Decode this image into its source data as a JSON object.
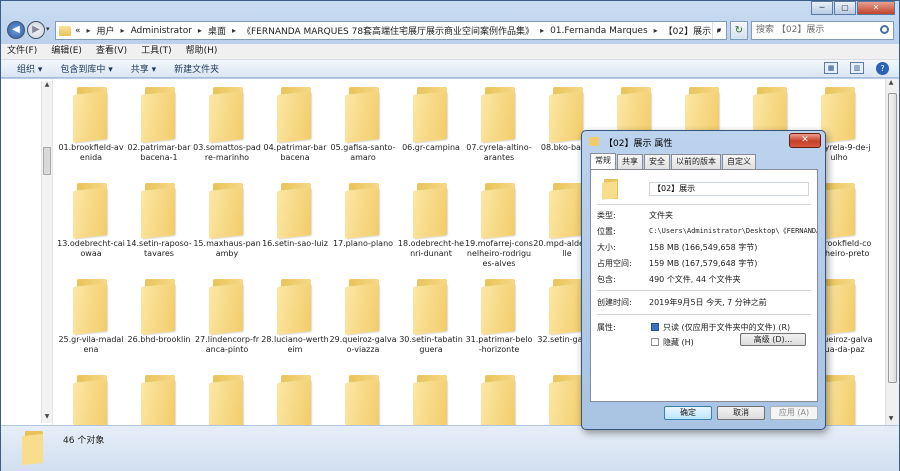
{
  "window": {
    "title": "",
    "minimize": "─",
    "maximize": "▢",
    "close": "✕"
  },
  "address": {
    "back": "◀",
    "forward": "▶",
    "crumbs": [
      "«",
      "用户",
      "Administrator",
      "桌面",
      "《FERNANDA MARQUES 78套高端住宅展厅展示商业空间案例作品集》",
      "01.Fernanda Marques",
      "【02】展示"
    ],
    "refresh": "↻",
    "search_placeholder": "搜索 【02】展示"
  },
  "menu": [
    "文件(F)",
    "编辑(E)",
    "查看(V)",
    "工具(T)",
    "帮助(H)"
  ],
  "commands": {
    "organize": "组织 ▾",
    "include": "包含到库中 ▾",
    "share": "共享 ▾",
    "new_folder": "新建文件夹",
    "view_icon": "▦",
    "pane_icon": "▥",
    "help": "?"
  },
  "files": [
    "01.brookfield-avenida",
    "02.patrimar-barbacena-1",
    "03.somattos-padre-marinho",
    "04.patrimar-barbacena",
    "05.gafisa-santo-amaro",
    "06.gr-campina",
    "07.cyrela-altino-arantes",
    "08.bko-bahia",
    "",
    "",
    "",
    "12.cyrela-9-de-julho",
    "13.odebrecht-caiowaa",
    "14.setin-raposo-tavares",
    "15.maxhaus-panamby",
    "16.setin-sao-luiz",
    "17.plano-plano",
    "18.odebrecht-henri-dunant",
    "19.mofarrej-consnelheiro-rodrigues-alves",
    "20.mpd-aldeia-ville",
    "",
    "",
    "",
    "24.brookfield-conselheiro-preto",
    "25.gr-vila-madalena",
    "26.bhd-brooklin",
    "27.lindencorp-franca-pinto",
    "28.luciano-wertheim",
    "29.queiroz-galvao-viazza",
    "30.setin-tabatinguera",
    "31.patrimar-belo-horizonte",
    "32.setin-gafisa",
    "",
    "",
    "",
    "36.queiroz-galvao-rua-da-paz",
    "",
    "",
    "",
    "",
    "",
    "",
    "",
    "",
    "",
    "",
    "",
    ""
  ],
  "status": {
    "count": "46 个对象"
  },
  "dialog": {
    "title": "【02】展示 属性",
    "close": "✕",
    "tabs": [
      "常规",
      "共享",
      "安全",
      "以前的版本",
      "自定义"
    ],
    "name": "【02】展示",
    "rows": [
      {
        "label": "类型:",
        "value": "文件夹"
      },
      {
        "label": "位置:",
        "value": "C:\\Users\\Administrator\\Desktop\\《FERNANDA"
      },
      {
        "label": "大小:",
        "value": "158 MB (166,549,658 字节)"
      },
      {
        "label": "占用空间:",
        "value": "159 MB (167,579,648 字节)"
      },
      {
        "label": "包含:",
        "value": "490 个文件, 44 个文件夹"
      },
      {
        "label": "创建时间:",
        "value": "2019年9月5日 今天, 7 分钟之前"
      },
      {
        "label": "属性:",
        "value": ""
      }
    ],
    "readonly": "只读 (仅应用于文件夹中的文件) (R)",
    "hidden": "隐藏 (H)",
    "advanced": "高级 (D)...",
    "ok": "确定",
    "cancel": "取消",
    "apply": "应用 (A)"
  }
}
